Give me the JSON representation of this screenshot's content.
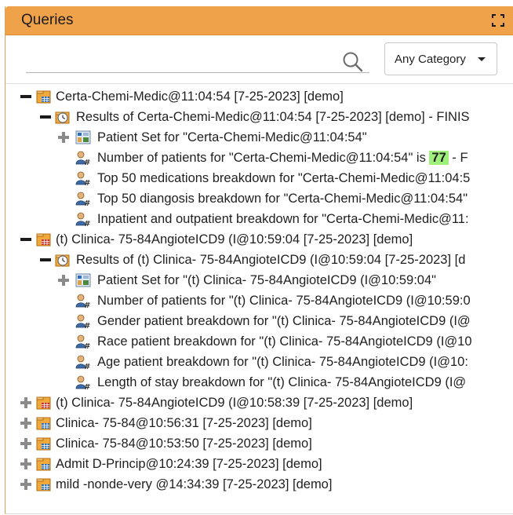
{
  "header": {
    "title": "Queries"
  },
  "search": {
    "value": "",
    "placeholder": ""
  },
  "category": {
    "selected": "Any Category"
  },
  "tree": {
    "r1": {
      "label": "Certa-Chemi-Medic@11:04:54 [7-25-2023] [demo]"
    },
    "r2": {
      "label": "Results of Certa-Chemi-Medic@11:04:54 [7-25-2023] [demo] - FINIS"
    },
    "r3": {
      "label": "Patient Set for \"Certa-Chemi-Medic@11:04:54\""
    },
    "r4": {
      "label_pre": "Number of patients for \"Certa-Chemi-Medic@11:04:54\" is ",
      "count": "77",
      "label_post": " - F"
    },
    "r5": {
      "label": "Top 50 medications breakdown for \"Certa-Chemi-Medic@11:04:5"
    },
    "r6": {
      "label": "Top 50 diangosis breakdown for \"Certa-Chemi-Medic@11:04:54\""
    },
    "r7": {
      "label": "Inpatient and outpatient breakdown for \"Certa-Chemi-Medic@11:"
    },
    "r8": {
      "label": "(t) Clinica- 75-84AngioteICD9 (I@10:59:04 [7-25-2023] [demo]"
    },
    "r9": {
      "label": "Results of (t) Clinica- 75-84AngioteICD9 (I@10:59:04 [7-25-2023] [d"
    },
    "r10": {
      "label": "Patient Set for \"(t) Clinica- 75-84AngioteICD9 (I@10:59:04\""
    },
    "r11": {
      "label": "Number of patients for \"(t) Clinica- 75-84AngioteICD9 (I@10:59:0"
    },
    "r12": {
      "label": "Gender patient breakdown for \"(t) Clinica- 75-84AngioteICD9 (I@"
    },
    "r13": {
      "label": "Race patient breakdown for \"(t) Clinica- 75-84AngioteICD9 (I@10"
    },
    "r14": {
      "label": "Age patient breakdown for \"(t) Clinica- 75-84AngioteICD9 (I@10:"
    },
    "r15": {
      "label": "Length of stay breakdown for \"(t) Clinica- 75-84AngioteICD9 (I@"
    },
    "r16": {
      "label": "(t) Clinica- 75-84AngioteICD9 (I@10:58:39 [7-25-2023] [demo]"
    },
    "r17": {
      "label": "Clinica- 75-84@10:56:31 [7-25-2023] [demo]"
    },
    "r18": {
      "label": "Clinica- 75-84@10:53:50 [7-25-2023] [demo]"
    },
    "r19": {
      "label": "Admit D-Princip@10:24:39 [7-25-2023] [demo]"
    },
    "r20": {
      "label": "mild -nonde-very @14:34:39 [7-25-2023] [demo]"
    }
  },
  "colors": {
    "header_bg": "#f0a24a",
    "count_highlight": "#9ff07a",
    "folder_orange": "#f2a93b",
    "folder_blue": "#2f6fb8"
  },
  "icons": {
    "expand": "expand-icon",
    "search": "search-icon",
    "query_folder": "query-folder-icon",
    "shared_query_folder": "shared-query-folder-icon",
    "results": "results-clock-icon",
    "patient_set": "patient-set-icon",
    "breakdown": "patient-breakdown-icon"
  }
}
